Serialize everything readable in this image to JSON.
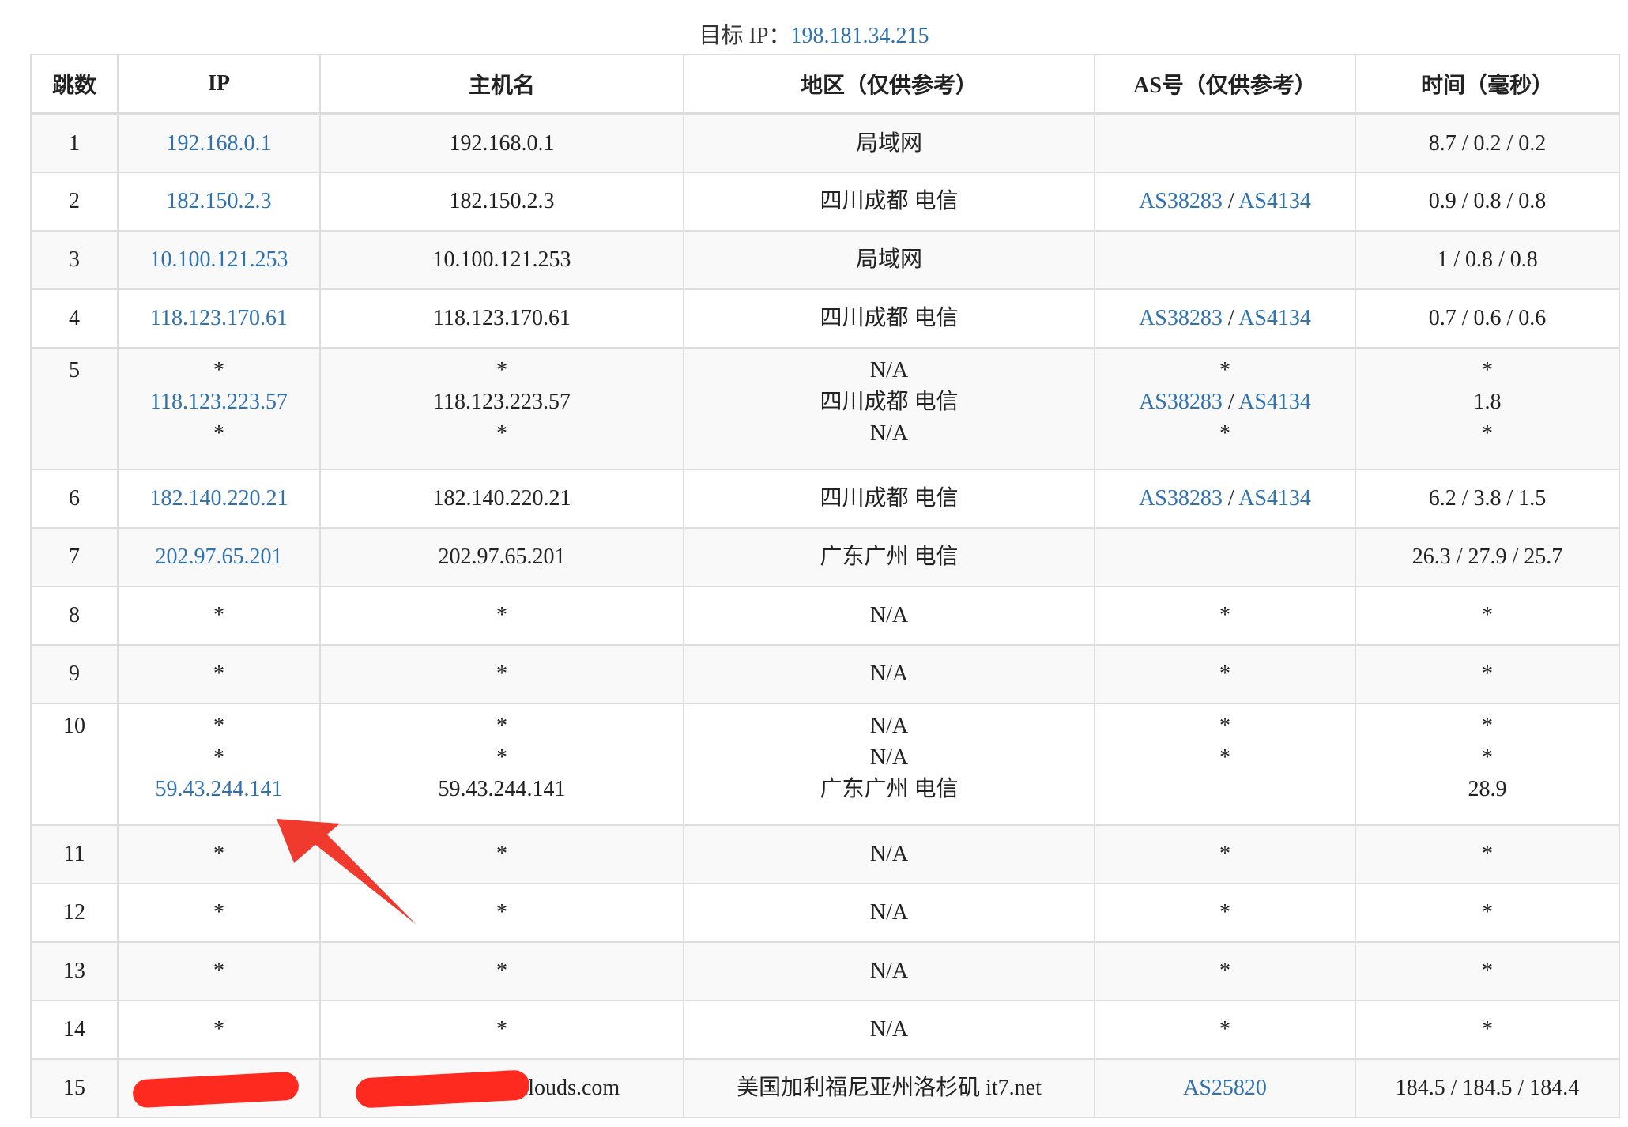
{
  "target": {
    "label": "目标 IP：",
    "ip": "198.181.34.215"
  },
  "columns": [
    "跳数",
    "IP",
    "主机名",
    "地区（仅供参考）",
    "AS号（仅供参考）",
    "时间（毫秒）"
  ],
  "rows": [
    {
      "hop": "1",
      "lines": [
        {
          "ip": "192.168.0.1",
          "host": "192.168.0.1",
          "region": "局域网",
          "as": [],
          "time": "8.7 / 0.2 / 0.2"
        }
      ]
    },
    {
      "hop": "2",
      "lines": [
        {
          "ip": "182.150.2.3",
          "host": "182.150.2.3",
          "region": "四川成都 电信",
          "as": [
            "AS38283",
            "AS4134"
          ],
          "time": "0.9 / 0.8 / 0.8"
        }
      ]
    },
    {
      "hop": "3",
      "lines": [
        {
          "ip": "10.100.121.253",
          "host": "10.100.121.253",
          "region": "局域网",
          "as": [],
          "time": "1 / 0.8 / 0.8"
        }
      ]
    },
    {
      "hop": "4",
      "lines": [
        {
          "ip": "118.123.170.61",
          "host": "118.123.170.61",
          "region": "四川成都 电信",
          "as": [
            "AS38283",
            "AS4134"
          ],
          "time": "0.7 / 0.6 / 0.6"
        }
      ]
    },
    {
      "hop": "5",
      "lines": [
        {
          "ip": "*",
          "host": "*",
          "region": "N/A",
          "as": [
            "*"
          ],
          "time": "*"
        },
        {
          "ip": "118.123.223.57",
          "host": "118.123.223.57",
          "region": "四川成都 电信",
          "as": [
            "AS38283",
            "AS4134"
          ],
          "time": "1.8"
        },
        {
          "ip": "*",
          "host": "*",
          "region": "N/A",
          "as": [
            "*"
          ],
          "time": "*"
        }
      ]
    },
    {
      "hop": "6",
      "lines": [
        {
          "ip": "182.140.220.21",
          "host": "182.140.220.21",
          "region": "四川成都 电信",
          "as": [
            "AS38283",
            "AS4134"
          ],
          "time": "6.2 / 3.8 / 1.5"
        }
      ]
    },
    {
      "hop": "7",
      "lines": [
        {
          "ip": "202.97.65.201",
          "host": "202.97.65.201",
          "region": "广东广州 电信",
          "as": [],
          "time": "26.3 / 27.9 / 25.7"
        }
      ]
    },
    {
      "hop": "8",
      "lines": [
        {
          "ip": "*",
          "host": "*",
          "region": "N/A",
          "as": [
            "*"
          ],
          "time": "*"
        }
      ]
    },
    {
      "hop": "9",
      "lines": [
        {
          "ip": "*",
          "host": "*",
          "region": "N/A",
          "as": [
            "*"
          ],
          "time": "*"
        }
      ]
    },
    {
      "hop": "10",
      "lines": [
        {
          "ip": "*",
          "host": "*",
          "region": "N/A",
          "as": [
            "*"
          ],
          "time": "*"
        },
        {
          "ip": "*",
          "host": "*",
          "region": "N/A",
          "as": [
            "*"
          ],
          "time": "*"
        },
        {
          "ip": "59.43.244.141",
          "host": "59.43.244.141",
          "region": "广东广州 电信",
          "as": [],
          "time": "28.9"
        }
      ]
    },
    {
      "hop": "11",
      "lines": [
        {
          "ip": "*",
          "host": "*",
          "region": "N/A",
          "as": [
            "*"
          ],
          "time": "*"
        }
      ]
    },
    {
      "hop": "12",
      "lines": [
        {
          "ip": "*",
          "host": "*",
          "region": "N/A",
          "as": [
            "*"
          ],
          "time": "*"
        }
      ]
    },
    {
      "hop": "13",
      "lines": [
        {
          "ip": "*",
          "host": "*",
          "region": "N/A",
          "as": [
            "*"
          ],
          "time": "*"
        }
      ]
    },
    {
      "hop": "14",
      "lines": [
        {
          "ip": "*",
          "host": "*",
          "region": "N/A",
          "as": [
            "*"
          ],
          "time": "*"
        }
      ]
    },
    {
      "hop": "15",
      "redacted": true,
      "lines": [
        {
          "ip": "",
          "host": "clouds.com",
          "region": "美国加利福尼亚州洛杉矶 it7.net",
          "as": [
            "AS25820"
          ],
          "time": "184.5 / 184.5 / 184.4"
        }
      ]
    }
  ],
  "annotation": {
    "color": "#f03a2e"
  }
}
